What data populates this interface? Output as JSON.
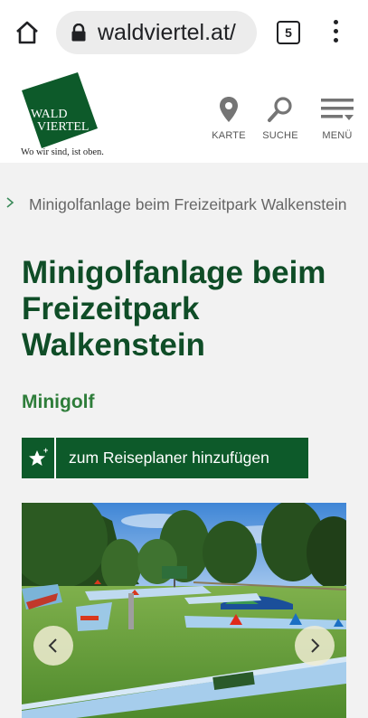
{
  "browser": {
    "url": "waldviertel.at/",
    "tab_count": "5"
  },
  "header": {
    "logo_line1": "WALD",
    "logo_line2": "VIERTEL",
    "tagline": "Wo wir sind, ist oben.",
    "nav": [
      {
        "label": "KARTE",
        "icon": "map-pin-icon"
      },
      {
        "label": "SUCHE",
        "icon": "search-icon"
      },
      {
        "label": "MENÜ",
        "icon": "menu-icon"
      }
    ]
  },
  "breadcrumb": {
    "current": "Minigolfanlage beim Freizeitpark Walkenstein"
  },
  "main": {
    "title": "Minigolfanlage beim Freizeitpark Walkenstein",
    "category": "Minigolf",
    "planner_button": "zum Reiseplaner hinzufügen"
  },
  "colors": {
    "brand_green": "#0d5a2a",
    "title_green": "#0f4d27",
    "category_green": "#2e7d3a"
  }
}
